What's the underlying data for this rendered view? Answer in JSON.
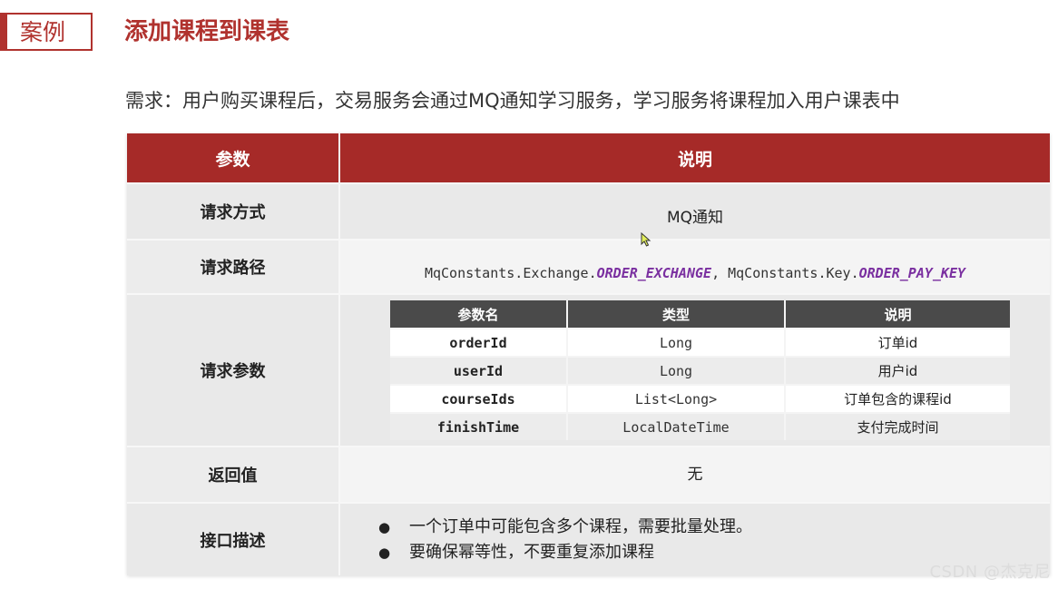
{
  "header": {
    "tag": "案例",
    "title": "添加课程到课表"
  },
  "requirement": "需求：用户购买课程后，交易服务会通过MQ通知学习服务，学习服务将课程加入用户课表中",
  "table": {
    "headers": [
      "参数",
      "说明"
    ],
    "method_label": "请求方式",
    "method_value": "MQ通知",
    "path_label": "请求路径",
    "path_value": {
      "p1": "MqConstants.Exchange.",
      "c1": "ORDER_EXCHANGE",
      "p2": ", MqConstants.Key.",
      "c2": "ORDER_PAY_KEY"
    },
    "params_label": "请求参数",
    "params_headers": [
      "参数名",
      "类型",
      "说明"
    ],
    "params": [
      {
        "name": "orderId",
        "type": "Long",
        "desc": "订单id"
      },
      {
        "name": "userId",
        "type": "Long",
        "desc": "用户id"
      },
      {
        "name": "courseIds",
        "type": "List<Long>",
        "desc": "订单包含的课程id"
      },
      {
        "name": "finishTime",
        "type": "LocalDateTime",
        "desc": "支付完成时间"
      }
    ],
    "return_label": "返回值",
    "return_value": "无",
    "desc_label": "接口描述",
    "desc_items": [
      "一个订单中可能包含多个课程，需要批量处理。",
      "要确保幂等性，不要重复添加课程"
    ]
  },
  "watermark": "CSDN @杰克尼",
  "colors": {
    "accent": "#a62a28",
    "sub_header": "#4a4a4a",
    "constant": "#7a2fa0"
  }
}
